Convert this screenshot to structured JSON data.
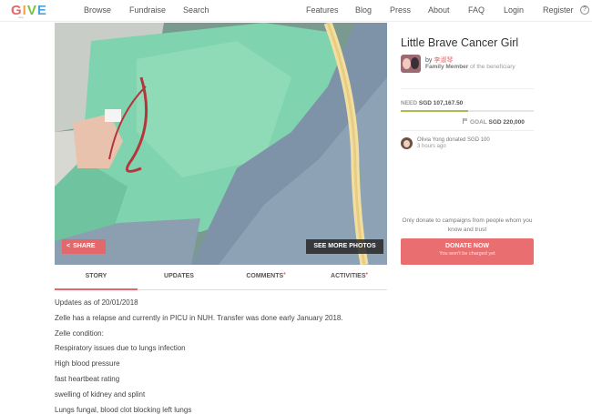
{
  "nav": {
    "logo": "GIVE",
    "logo_sub": "asia",
    "links": [
      "Browse",
      "Fundraise",
      "Search",
      "Features",
      "Blog",
      "Press",
      "About",
      "FAQ",
      "Login",
      "Register"
    ],
    "help_icon": "?"
  },
  "hero": {
    "share_label": "SHARE",
    "see_more_label": "SEE MORE PHOTOS"
  },
  "tabs": [
    {
      "label": "STORY",
      "active": true,
      "dot": false
    },
    {
      "label": "UPDATES",
      "active": false,
      "dot": false
    },
    {
      "label": "COMMENTS",
      "active": false,
      "dot": true
    },
    {
      "label": "ACTIVITIES",
      "active": false,
      "dot": true
    }
  ],
  "story": [
    "Updates as of 20/01/2018",
    "Zelle has a relapse and currently in PICU in NUH. Transfer was done early January 2018.",
    "Zelle condition:",
    "Respiratory issues due to lungs infection",
    "High blood pressure",
    "fast heartbeat rating",
    "swelling of kidney and splint",
    "Lungs fungal, blood clot blocking left lungs"
  ],
  "campaign": {
    "title": "Little Brave Cancer Girl",
    "by_prefix": "by",
    "by_name": "李淑琴",
    "role_bold": "Family Member",
    "role_rest": " of the beneficiary",
    "need_label": "NEED",
    "need_value": "SGD 107,167.50",
    "goal_label": "GOAL",
    "goal_value": "SGD 220,000",
    "progress_fraction": 0.51
  },
  "donation": {
    "text": "Olivia Yong donated SGD 100",
    "time": "3 hours ago"
  },
  "cta": {
    "advice": "Only donate to campaigns from people whom you know and trust",
    "donate_label": "DONATE NOW",
    "donate_sub": "You won't be charged yet"
  },
  "colors": {
    "accent": "#e96e6f",
    "progress": "#a7bf4f"
  }
}
